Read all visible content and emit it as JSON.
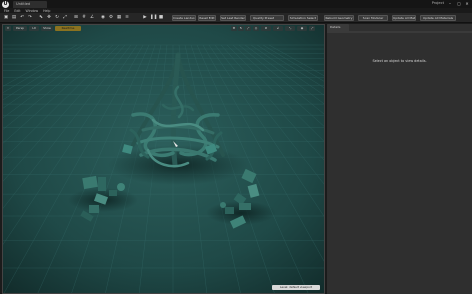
{
  "titlebar": {
    "logo": "U",
    "doc_tab": "Untitled",
    "project": "Project",
    "buttons": {
      "minimize": "–",
      "maximize": "▢",
      "close": "✕"
    }
  },
  "menu": [
    "File",
    "Edit",
    "Window",
    "Help"
  ],
  "toolbar": {
    "labels": {
      "create_landscape": "Create Landscape",
      "reset_edit": "Reset Edit",
      "set_last_render": "Set Last Render",
      "quality_preset": "Quality Preset",
      "simulation_select": "Simulation Select",
      "rebuild_geometry": "Rebuild Geometry",
      "scan_modular": "Scan Modular",
      "update_all_materials": "Update All Materials"
    }
  },
  "viewport": {
    "chips": {
      "perspective": "Persp",
      "lit": "Lit",
      "show": "Show",
      "realtime": "Realtime"
    },
    "status": "Level: default viewport"
  },
  "details": {
    "tab": "Details",
    "message": "Select an object to view details."
  },
  "colors": {
    "viewport_bg": "#1e4a48",
    "grid": "#2f6261",
    "object": "#2f6f68",
    "panel": "#2f2f2f",
    "accent": "#8a7220"
  }
}
